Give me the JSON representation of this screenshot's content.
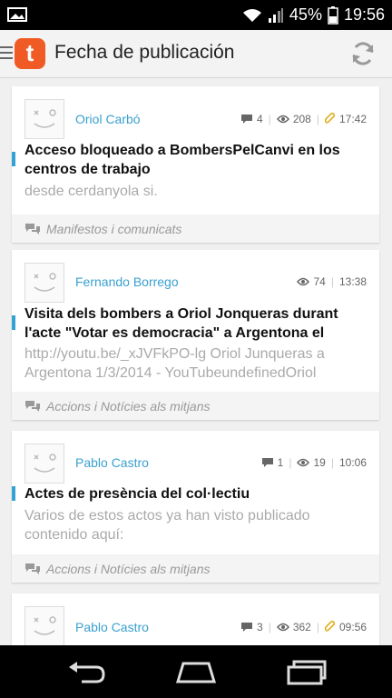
{
  "status": {
    "battery": "45%",
    "time": "19:56"
  },
  "appbar": {
    "title": "Fecha de publicación",
    "logo_letter": "t"
  },
  "posts": [
    {
      "author": "Oriol Carbó",
      "comments": "4",
      "views": "208",
      "time": "17:42",
      "has_attachment": true,
      "title_lines": [
        "Acceso bloqueado a BombersPelCanvi en los",
        "centros de trabajo"
      ],
      "excerpt_lines": [
        "desde cerdanyola si."
      ],
      "category": "Manifestos i comunicats"
    },
    {
      "author": "Fernando Borrego",
      "views": "74",
      "time": "13:38",
      "title_lines": [
        "Visita dels bombers a Oriol Jonqueras durant",
        "l'acte \"Votar es democracia\" a Argentona el"
      ],
      "excerpt_lines": [
        "http://youtu.be/_xJVFkPO-lg Oriol Junqueras a",
        "Argentona 1/3/2014 - YouTubeundefinedOriol"
      ],
      "category": "Accions i Notícies als mitjans"
    },
    {
      "author": "Pablo Castro",
      "comments": "1",
      "views": "19",
      "time": "10:06",
      "title_lines": [
        "Actes de presència del col·lectiu"
      ],
      "excerpt_lines": [
        "Varios de estos actos ya han visto publicado",
        "contenido aquí:"
      ],
      "category": "Accions i Notícies als mitjans"
    },
    {
      "author": "Pablo Castro",
      "comments": "3",
      "views": "362",
      "time": "09:56",
      "has_attachment": true
    }
  ],
  "colors": {
    "accent": "#3aa0d0",
    "logo": "#f05a24",
    "attachment": "#e0b020"
  },
  "icons": [
    "picture-icon",
    "wifi-icon",
    "signal-icon",
    "battery-icon",
    "menu-icon",
    "refresh-icon",
    "comment-icon",
    "eye-icon",
    "paperclip-icon",
    "chat-bubbles-icon",
    "back-icon",
    "home-icon",
    "recents-icon"
  ]
}
